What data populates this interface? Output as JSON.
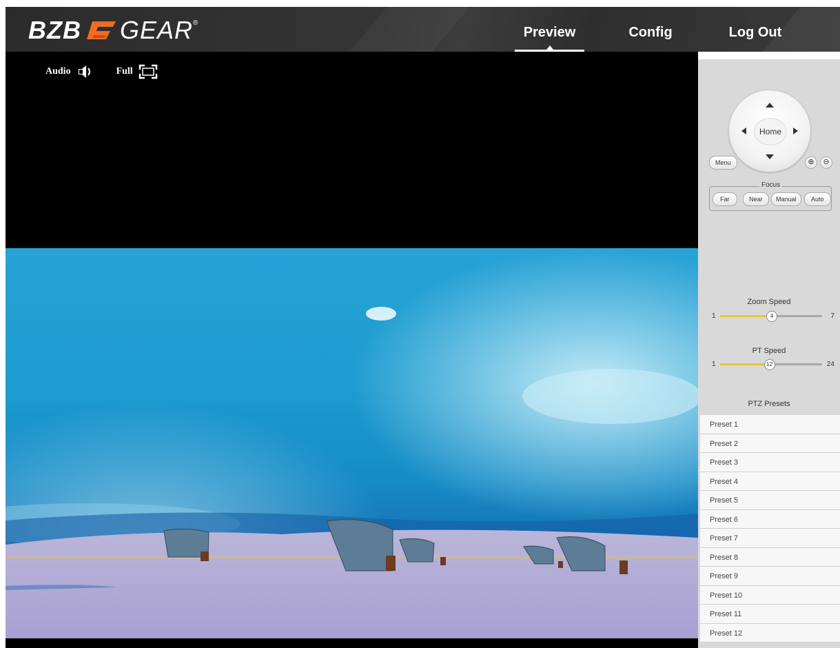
{
  "brand": {
    "left": "BZB",
    "right": "GEAR",
    "reg": "®",
    "accent": "#ef6c22"
  },
  "nav": [
    {
      "id": "preview",
      "label": "Preview",
      "active": true
    },
    {
      "id": "config",
      "label": "Config",
      "active": false
    },
    {
      "id": "logout",
      "label": "Log Out",
      "active": false
    }
  ],
  "toolbar": {
    "audio_label": "Audio",
    "full_label": "Full"
  },
  "ptz": {
    "home_label": "Home",
    "menu_label": "Menu",
    "zoom_in_icon": "zoom-in-icon",
    "zoom_out_icon": "zoom-out-icon"
  },
  "focus": {
    "legend": "Focus",
    "buttons": [
      "Far",
      "Near",
      "Manual",
      "Auto"
    ]
  },
  "zoom_speed": {
    "label": "Zoom Speed",
    "min": "1",
    "max": "7",
    "value": "4",
    "fraction": 0.5
  },
  "pt_speed": {
    "label": "PT Speed",
    "min": "1",
    "max": "24",
    "value": "12",
    "fraction": 0.478
  },
  "presets": {
    "title": "PTZ Presets",
    "items": [
      "Preset  1",
      "Preset  2",
      "Preset  3",
      "Preset  4",
      "Preset  5",
      "Preset  6",
      "Preset  7",
      "Preset  8",
      "Preset  9",
      "Preset  10",
      "Preset  11",
      "Preset  12"
    ]
  }
}
